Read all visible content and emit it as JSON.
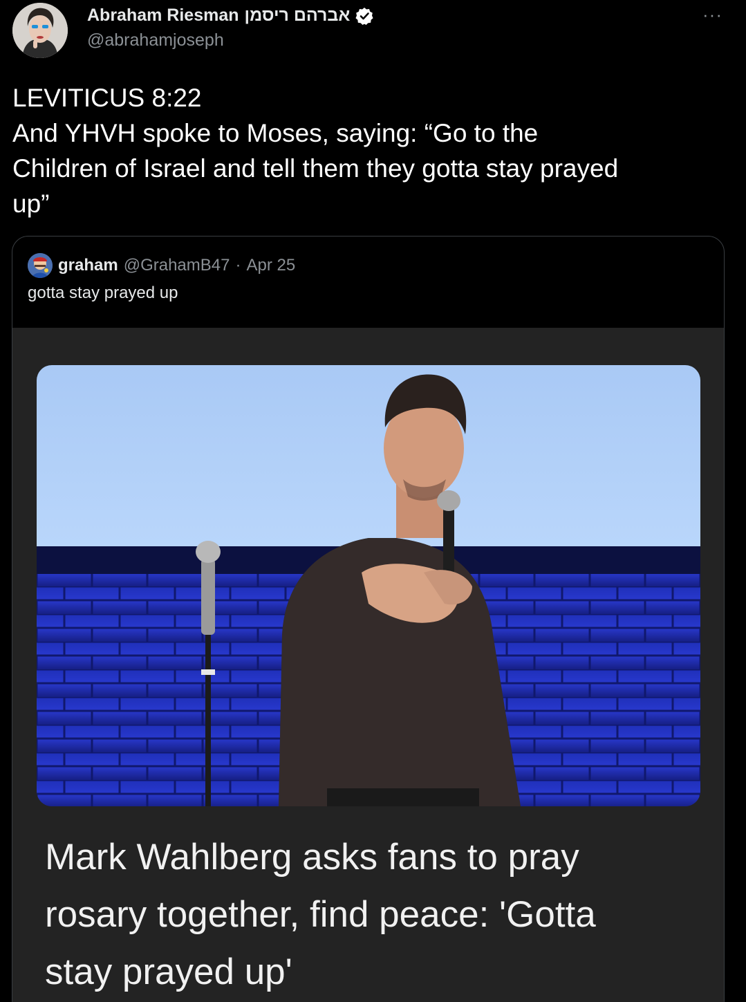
{
  "author": {
    "name": "Abraham Riesman",
    "hebrew_name": "אברהם ריסמן",
    "handle": "@abrahamjoseph",
    "verified_icon": "verified-badge-icon",
    "avatar_icon": "user-avatar"
  },
  "more_icon": "more-options-icon",
  "tweet": {
    "line1": "LEVITICUS 8:22",
    "line2": "And YHVH spoke to Moses, saying: “Go to the",
    "line3": "Children of Israel and tell them they gotta stay prayed",
    "line4": "up”"
  },
  "quote": {
    "name": "graham",
    "handle": "@GrahamB47",
    "separator": "·",
    "date": "Apr 25",
    "text": "gotta stay prayed up",
    "avatar_icon": "quoted-user-avatar",
    "card": {
      "image": "photo-man-speaking-on-stage",
      "headline_line1": "Mark Wahlberg asks fans to pray",
      "headline_line2": "rosary together, find peace: 'Gotta",
      "headline_line3": "stay prayed up'"
    }
  },
  "colors": {
    "background": "#000000",
    "text_primary": "#e7e9ea",
    "text_secondary": "#8b9095",
    "border": "#3a3e42",
    "card_bg": "#232323",
    "verified": "#ffffff"
  }
}
